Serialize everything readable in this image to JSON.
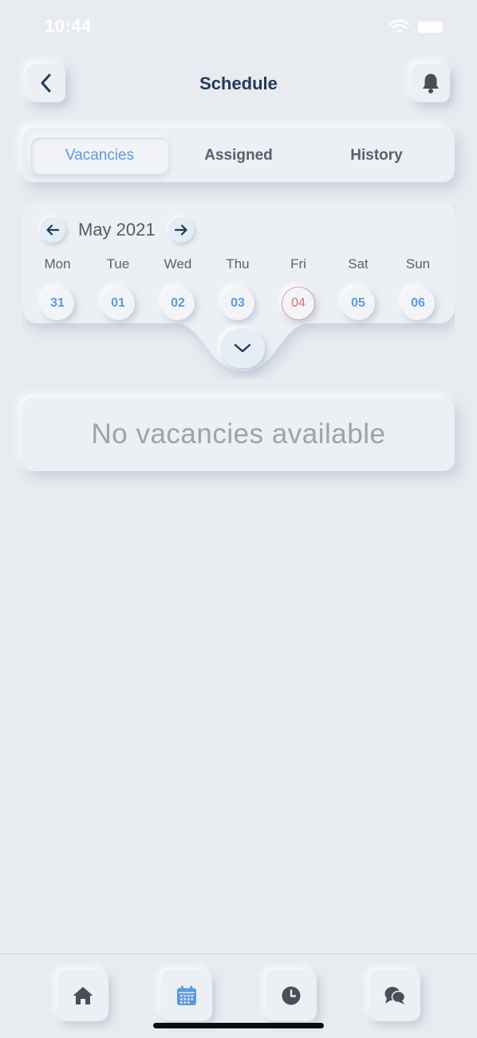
{
  "status_bar": {
    "time": "10:44",
    "icons": [
      "wifi-icon",
      "battery-icon"
    ]
  },
  "header": {
    "title": "Schedule",
    "back_icon": "chevron-left-icon",
    "bell_icon": "bell-icon"
  },
  "tabs": [
    {
      "label": "Vacancies",
      "active": true
    },
    {
      "label": "Assigned",
      "active": false
    },
    {
      "label": "History",
      "active": false
    }
  ],
  "calendar": {
    "month_label": "May 2021",
    "prev_icon": "arrow-left-icon",
    "next_icon": "arrow-right-icon",
    "days": [
      {
        "name": "Mon",
        "date": "31",
        "today": false
      },
      {
        "name": "Tue",
        "date": "01",
        "today": false
      },
      {
        "name": "Wed",
        "date": "02",
        "today": false
      },
      {
        "name": "Thu",
        "date": "03",
        "today": false
      },
      {
        "name": "Fri",
        "date": "04",
        "today": true
      },
      {
        "name": "Sat",
        "date": "05",
        "today": false
      },
      {
        "name": "Sun",
        "date": "06",
        "today": false
      }
    ],
    "expand_icon": "chevron-down-icon"
  },
  "empty_state": {
    "message": "No vacancies available"
  },
  "bottom_nav": [
    {
      "icon": "home-icon",
      "active": false
    },
    {
      "icon": "calendar-icon",
      "active": true
    },
    {
      "icon": "clock-icon",
      "active": false
    },
    {
      "icon": "chat-icon",
      "active": false
    }
  ],
  "colors": {
    "background": "#e8ebf0",
    "accent_blue": "#5b9be0",
    "today_red": "#e26f70",
    "title_navy": "#1f3a5c",
    "icon_gray": "#4a4e58"
  }
}
